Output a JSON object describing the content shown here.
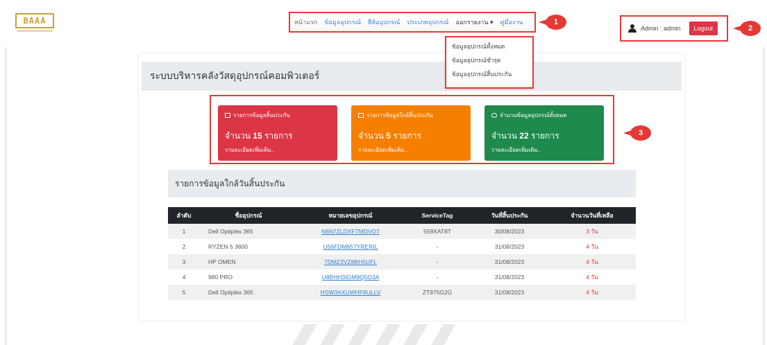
{
  "logo": {
    "text": "BAAA"
  },
  "nav": {
    "items": [
      {
        "label": "หน้าแรก"
      },
      {
        "label": "ข้อมูลอุปกรณ์"
      },
      {
        "label": "ยี่ห้ออุปกรณ์"
      },
      {
        "label": "ประเภทอุปกรณ์"
      },
      {
        "label": "ออกรายงาน ▾"
      },
      {
        "label": "คู่มืองาน"
      }
    ],
    "dropdown": [
      {
        "label": "ข้อมูลอุปกรณ์ทั้งหมด"
      },
      {
        "label": "ข้อมูลอุปกรณ์ชำรุด"
      },
      {
        "label": "ข้อมูลอุปกรณ์สิ้นประกัน"
      }
    ]
  },
  "user": {
    "label": "Admin : admin",
    "logout": "Logout"
  },
  "annotations": [
    "1",
    "2",
    "3"
  ],
  "page_title": "ระบบบริหารคลังวัสดุอุปกรณ์คอมพิวเตอร์",
  "cards": [
    {
      "heading": "รายการข้อมูลสิ้นประกัน",
      "count_prefix": "จำนวน",
      "count": "15",
      "count_suffix": "รายการ",
      "more": "รายละเอียดเพิ่มเติม..",
      "color": "#dc3545"
    },
    {
      "heading": "รายการข้อมูลใกล้สิ้นประกัน",
      "count_prefix": "จำนวน",
      "count": "5",
      "count_suffix": "รายการ",
      "more": "รายละเอียดเพิ่มเติม..",
      "color": "#f77f00"
    },
    {
      "heading": "จำนวนข้อมูลอุปกรณ์ทั้งหมด",
      "count_prefix": "จำนวน",
      "count": "22",
      "count_suffix": "รายการ",
      "more": "รายละเอียดเพิ่มเติม..",
      "color": "#1e8a4c"
    }
  ],
  "section_title": "รายการข้อมูลใกล้วันสิ้นประกัน",
  "table": {
    "headers": [
      "ลำดับ",
      "ชื่ออุปกรณ์",
      "หมายเลขอุปกรณ์",
      "ServiceTag",
      "วันที่สิ้นประกัน",
      "จำนวนวันที่เหลือ"
    ],
    "rows": [
      {
        "no": "1",
        "name": "Dell Optiplex 365",
        "serial": "N6N7ZLDXFTMDVO7",
        "tag": "559XAT8T",
        "date": "30/08/2023",
        "days": "3 วัน"
      },
      {
        "no": "2",
        "name": "RYZEN 5 3600",
        "serial": "U56FDM857YRERIL",
        "tag": "-",
        "date": "31/08/2023",
        "days": "4 วัน"
      },
      {
        "no": "3",
        "name": "HP OMEN",
        "serial": "7DMZ3VZ8BH5UFL",
        "tag": "-",
        "date": "31/08/2023",
        "days": "4 วัน"
      },
      {
        "no": "4",
        "name": "980 PRO",
        "serial": "U8BHH3IGM9Q5O3A",
        "tag": "-",
        "date": "31/08/2023",
        "days": "4 วัน"
      },
      {
        "no": "5",
        "name": "Dell Optiplex 365",
        "serial": "HSW3AXUWHF8ULLV",
        "tag": "ZT975G2G",
        "date": "31/08/2023",
        "days": "4 วัน"
      }
    ]
  },
  "colors": {
    "annotation": "#e53935",
    "link": "#2f7fd1",
    "dark_header": "#212529"
  }
}
